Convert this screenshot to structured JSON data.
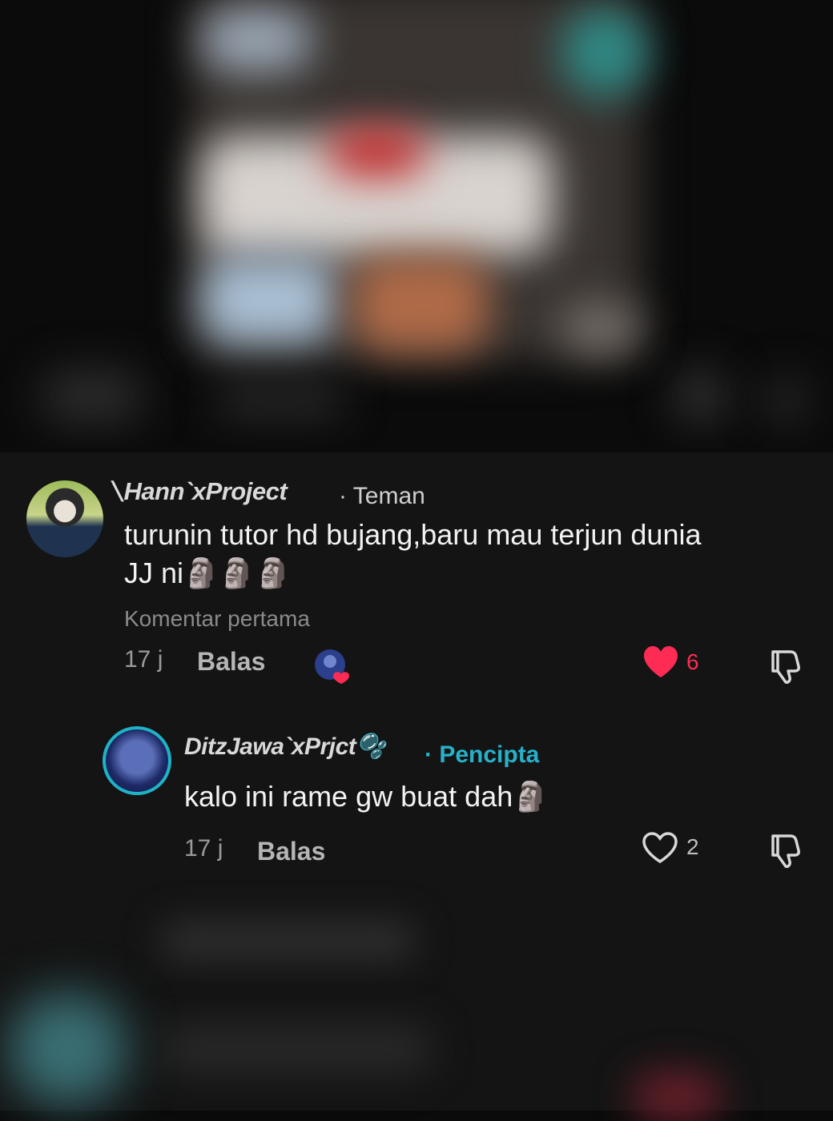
{
  "comments": [
    {
      "username": "⃥Hann`xProject",
      "badge": "· Teman",
      "text_line1": "turunin tutor hd bujang,baru mau terjun dunia",
      "text_line2": "JJ ni🗿🗿🗿",
      "note": "Komentar pertama",
      "time": "17 j",
      "reply_label": "Balas",
      "likes": "6",
      "liked": true
    }
  ],
  "reply": {
    "username": "DitzJawa`xPrjct🫧",
    "badge": "· Pencipta",
    "text": "kalo ini rame gw buat dah🗿",
    "time": "17 j",
    "reply_label": "Balas",
    "likes": "2",
    "liked": false
  },
  "colors": {
    "like_red": "#fe2c55",
    "creator_accent": "#27b0c9"
  },
  "icons": [
    "heart-filled-icon",
    "heart-outline-icon",
    "dislike-icon",
    "liked-by-creator-avatar"
  ]
}
